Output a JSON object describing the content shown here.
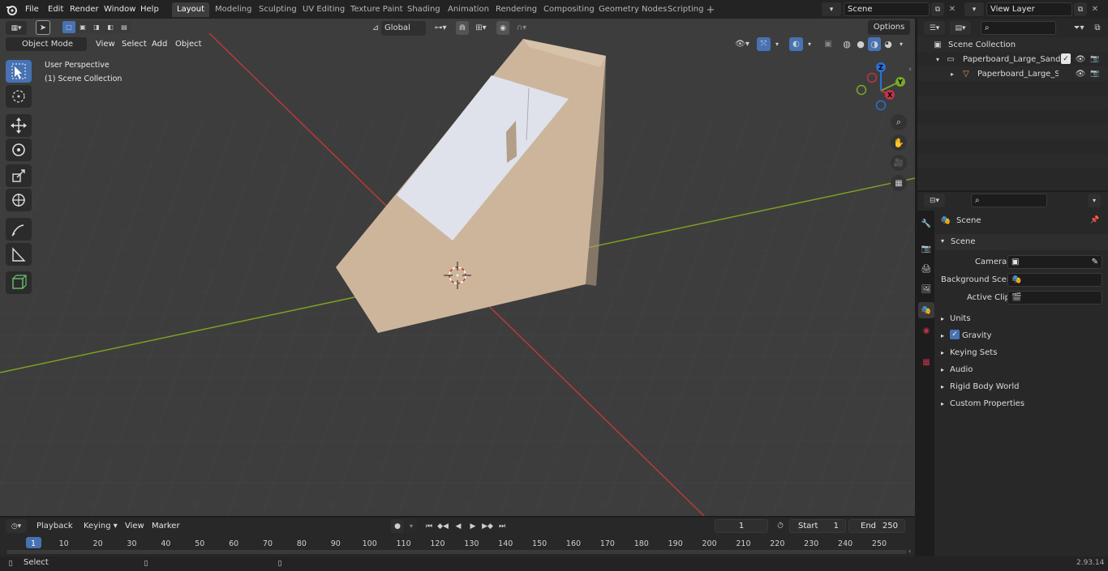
{
  "topbar": {
    "menus": [
      "File",
      "Edit",
      "Render",
      "Window",
      "Help"
    ],
    "workspaces": [
      "Layout",
      "Modeling",
      "Sculpting",
      "UV Editing",
      "Texture Paint",
      "Shading",
      "Animation",
      "Rendering",
      "Compositing",
      "Geometry Nodes",
      "Scripting"
    ],
    "active_workspace": "Layout",
    "scene_name": "Scene",
    "view_layer": "View Layer"
  },
  "viewport": {
    "mode": "Object Mode",
    "menus": [
      "View",
      "Select",
      "Add",
      "Object"
    ],
    "transform_orientation": "Global",
    "options_label": "Options",
    "overlay_line1": "User Perspective",
    "overlay_line2": "(1) Scene Collection",
    "gizmo_axes": {
      "x": "X",
      "y": "Y",
      "z": "Z"
    }
  },
  "outliner": {
    "root": "Scene Collection",
    "item1": "Paperboard_Large_Sandwich_",
    "item2": "Paperboard_Large_Sandı"
  },
  "properties": {
    "header": "Scene",
    "panel": "Scene",
    "camera_label": "Camera",
    "background_scene_label": "Background Scene",
    "active_clip_label": "Active Clip",
    "sections": [
      "Units",
      "Gravity",
      "Keying Sets",
      "Audio",
      "Rigid Body World",
      "Custom Properties"
    ]
  },
  "timeline": {
    "menus": [
      "Playback",
      "Keying",
      "View",
      "Marker"
    ],
    "current_frame": "1",
    "start_label": "Start",
    "start_value": "1",
    "end_label": "End",
    "end_value": "250",
    "ticks": [
      "1",
      "10",
      "20",
      "30",
      "40",
      "50",
      "60",
      "70",
      "80",
      "90",
      "100",
      "110",
      "120",
      "130",
      "140",
      "150",
      "160",
      "170",
      "180",
      "190",
      "200",
      "210",
      "220",
      "230",
      "240",
      "250"
    ]
  },
  "statusbar": {
    "left": "Select",
    "version": "2.93.14"
  },
  "colors": {
    "accent": "#4772b3",
    "x_axis": "#b83a3a",
    "y_axis": "#7da024",
    "box": "#cdb59c"
  }
}
